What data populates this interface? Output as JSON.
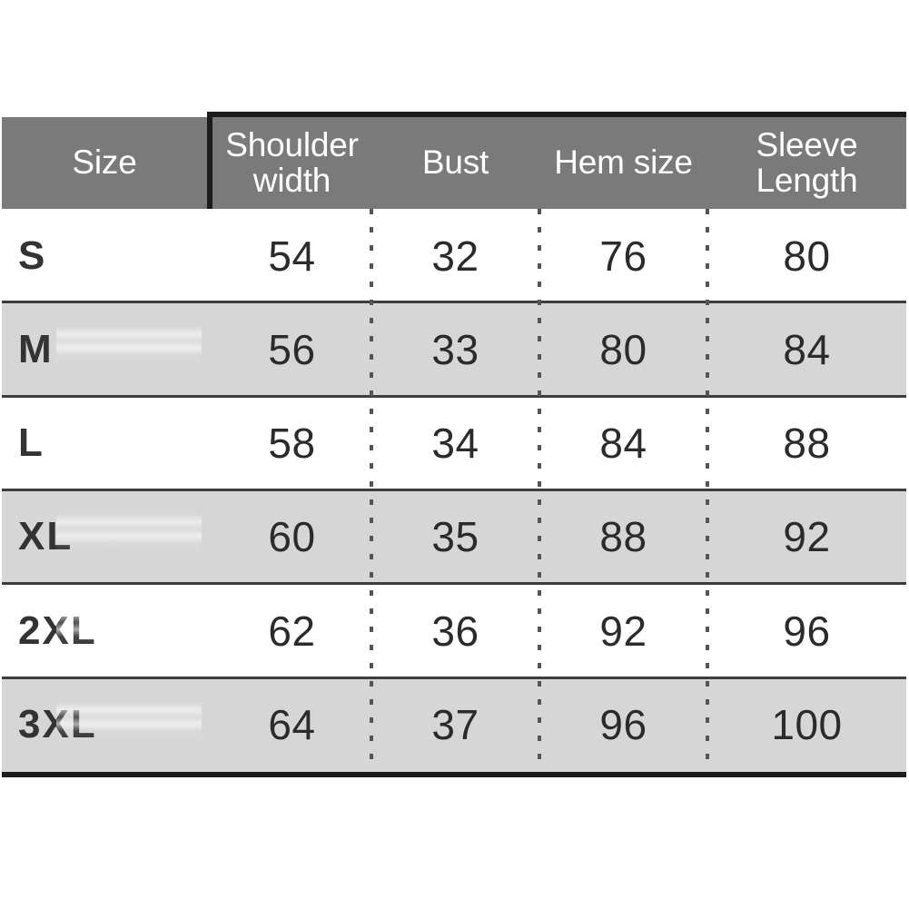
{
  "chart_data": {
    "type": "table",
    "title": "",
    "columns": [
      "Size",
      "Shoulder width",
      "Bust",
      "Hem size",
      "Sleeve Length"
    ],
    "rows": [
      {
        "size": "S",
        "shoulder_width": "54",
        "bust": "32",
        "hem_size": "76",
        "sleeve_length": "80"
      },
      {
        "size": "M",
        "shoulder_width": "56",
        "bust": "33",
        "hem_size": "80",
        "sleeve_length": "84"
      },
      {
        "size": "L",
        "shoulder_width": "58",
        "bust": "34",
        "hem_size": "84",
        "sleeve_length": "88"
      },
      {
        "size": "XL",
        "shoulder_width": "60",
        "bust": "35",
        "hem_size": "88",
        "sleeve_length": "92"
      },
      {
        "size": "2XL",
        "shoulder_width": "62",
        "bust": "36",
        "hem_size": "92",
        "sleeve_length": "96"
      },
      {
        "size": "3XL",
        "shoulder_width": "64",
        "bust": "37",
        "hem_size": "96",
        "sleeve_length": "100"
      }
    ],
    "colors": {
      "header_background": "#7a7a7a",
      "header_text": "#ffffff",
      "row_alt_background": "#d6d6d6",
      "row_plain_background": "#ffffff",
      "body_text": "#2b2b2b",
      "frame": "#1c1c1c",
      "rule": "#3d3d3d",
      "page_background": "#ffffff"
    },
    "grid": true,
    "legend": "none"
  },
  "table": {
    "header": {
      "size": "Size",
      "shoulder_width": "Shoulder width",
      "bust": "Bust",
      "hem_size": "Hem size",
      "sleeve_length": "Sleeve Length"
    },
    "rows": [
      {
        "size": "S",
        "v0": "54",
        "v1": "32",
        "v2": "76",
        "v3": "80"
      },
      {
        "size": "M",
        "v0": "56",
        "v1": "33",
        "v2": "80",
        "v3": "84"
      },
      {
        "size": "L",
        "v0": "58",
        "v1": "34",
        "v2": "84",
        "v3": "88"
      },
      {
        "size": "XL",
        "v0": "60",
        "v1": "35",
        "v2": "88",
        "v3": "92"
      },
      {
        "size": "2XL",
        "v0": "62",
        "v1": "36",
        "v2": "92",
        "v3": "96"
      },
      {
        "size": "3XL",
        "v0": "64",
        "v1": "37",
        "v2": "96",
        "v3": "100"
      }
    ]
  }
}
